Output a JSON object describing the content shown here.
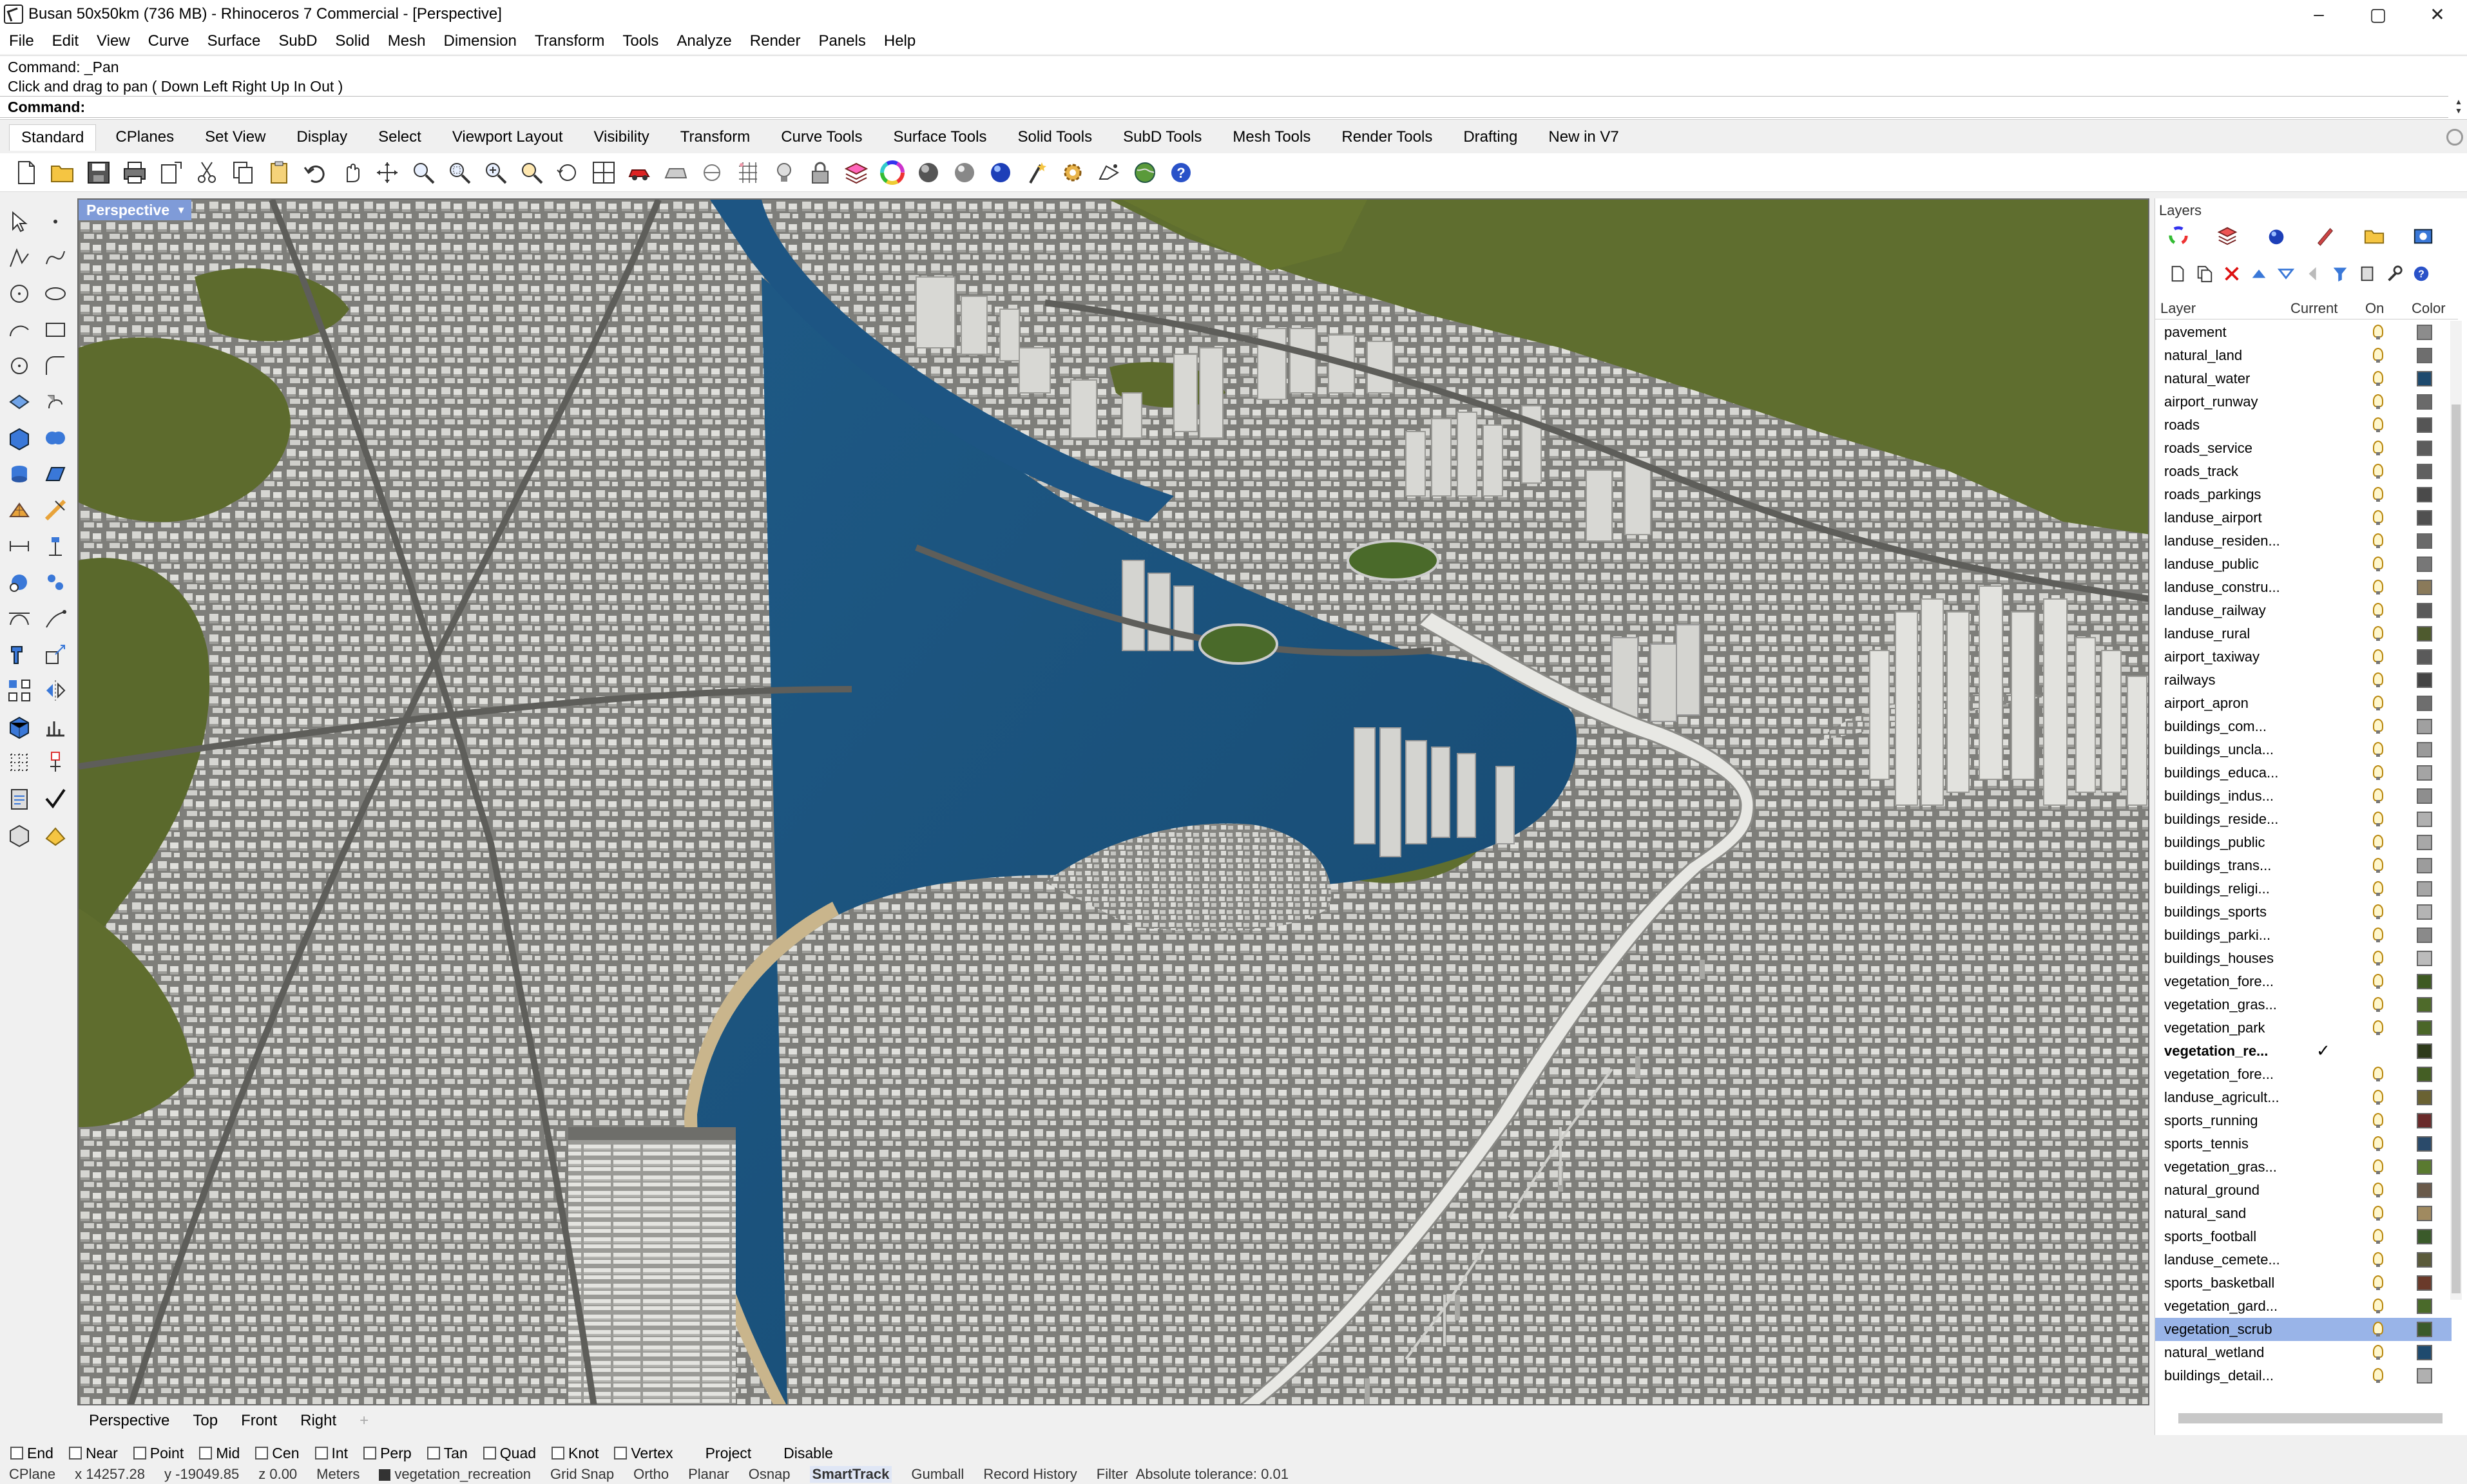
{
  "window": {
    "title": "Busan 50x50km (736 MB) - Rhinoceros 7 Commercial - [Perspective]",
    "minimize": "–",
    "maximize": "▢",
    "close": "✕"
  },
  "menu": [
    "File",
    "Edit",
    "View",
    "Curve",
    "Surface",
    "SubD",
    "Solid",
    "Mesh",
    "Dimension",
    "Transform",
    "Tools",
    "Analyze",
    "Render",
    "Panels",
    "Help"
  ],
  "command": {
    "history_1": "Command: _Pan",
    "history_2": "Click and drag to pan ( Down  Left  Right  Up  In  Out )",
    "prompt_label": "Command:",
    "input_value": ""
  },
  "toolbar_tabs": [
    "Standard",
    "CPlanes",
    "Set View",
    "Display",
    "Select",
    "Viewport Layout",
    "Visibility",
    "Transform",
    "Curve Tools",
    "Surface Tools",
    "Solid Tools",
    "SubD Tools",
    "Mesh Tools",
    "Render Tools",
    "Drafting",
    "New in V7"
  ],
  "active_tab": "Standard",
  "viewport": {
    "label": "Perspective",
    "caret": "▾"
  },
  "viewport_tabs": [
    "Perspective",
    "Top",
    "Front",
    "Right"
  ],
  "viewport_tab_add": "+",
  "layers": {
    "panel_title": "Layers",
    "columns": {
      "layer": "Layer",
      "current": "Current",
      "on": "On",
      "color": "Color"
    },
    "check_mark": "✓",
    "items": [
      {
        "name": "pavement",
        "color": "#8c8c8c"
      },
      {
        "name": "natural_land",
        "color": "#6e6e6e"
      },
      {
        "name": "natural_water",
        "color": "#1e4a6e"
      },
      {
        "name": "airport_runway",
        "color": "#6a6a6a"
      },
      {
        "name": "roads",
        "color": "#555555"
      },
      {
        "name": "roads_service",
        "color": "#5c5c5c"
      },
      {
        "name": "roads_track",
        "color": "#606060"
      },
      {
        "name": "roads_parkings",
        "color": "#4a4a4a"
      },
      {
        "name": "landuse_airport",
        "color": "#505050"
      },
      {
        "name": "landuse_residen...",
        "color": "#6a6a6a"
      },
      {
        "name": "landuse_public",
        "color": "#777777"
      },
      {
        "name": "landuse_constru...",
        "color": "#8a7a5a"
      },
      {
        "name": "landuse_railway",
        "color": "#5a5a5a"
      },
      {
        "name": "landuse_rural",
        "color": "#4e5a2e"
      },
      {
        "name": "airport_taxiway",
        "color": "#5a5a5a"
      },
      {
        "name": "railways",
        "color": "#444444"
      },
      {
        "name": "airport_apron",
        "color": "#6e6e6e"
      },
      {
        "name": "buildings_com...",
        "color": "#a0a0a0"
      },
      {
        "name": "buildings_uncla...",
        "color": "#9a9a9a"
      },
      {
        "name": "buildings_educa...",
        "color": "#a4a4a4"
      },
      {
        "name": "buildings_indus...",
        "color": "#8e8e8e"
      },
      {
        "name": "buildings_reside...",
        "color": "#b0b0b0"
      },
      {
        "name": "buildings_public",
        "color": "#a8a8a8"
      },
      {
        "name": "buildings_trans...",
        "color": "#9c9c9c"
      },
      {
        "name": "buildings_religi...",
        "color": "#a6a6a6"
      },
      {
        "name": "buildings_sports",
        "color": "#b4b4b4"
      },
      {
        "name": "buildings_parki...",
        "color": "#8a8a8a"
      },
      {
        "name": "buildings_houses",
        "color": "#bcbcbc"
      },
      {
        "name": "vegetation_fore...",
        "color": "#3e5a22"
      },
      {
        "name": "vegetation_gras...",
        "color": "#4e6a2a"
      },
      {
        "name": "vegetation_park",
        "color": "#4a6628"
      },
      {
        "name": "vegetation_re...",
        "color": "#2e3a1a",
        "current": true
      },
      {
        "name": "vegetation_fore...",
        "color": "#445e24"
      },
      {
        "name": "landuse_agricult...",
        "color": "#6a6232"
      },
      {
        "name": "sports_running",
        "color": "#6a2a2a"
      },
      {
        "name": "sports_tennis",
        "color": "#2a4a6a"
      },
      {
        "name": "vegetation_gras...",
        "color": "#5a7a30"
      },
      {
        "name": "natural_ground",
        "color": "#6a5a4a"
      },
      {
        "name": "natural_sand",
        "color": "#a08a60"
      },
      {
        "name": "sports_football",
        "color": "#3a5a2a"
      },
      {
        "name": "landuse_cemete...",
        "color": "#5a5a3a"
      },
      {
        "name": "sports_basketball",
        "color": "#6a3a2a"
      },
      {
        "name": "vegetation_gard...",
        "color": "#4a6a2a"
      },
      {
        "name": "vegetation_scrub",
        "color": "#3a5a2a",
        "selected": true
      },
      {
        "name": "natural_wetland",
        "color": "#1e4a6e"
      },
      {
        "name": "buildings_detail...",
        "color": "#b0b0b0"
      }
    ]
  },
  "osnap": {
    "items": [
      {
        "label": "End"
      },
      {
        "label": "Near"
      },
      {
        "label": "Point"
      },
      {
        "label": "Mid"
      },
      {
        "label": "Cen"
      },
      {
        "label": "Int"
      },
      {
        "label": "Perp"
      },
      {
        "label": "Tan"
      },
      {
        "label": "Quad"
      },
      {
        "label": "Knot"
      },
      {
        "label": "Vertex"
      },
      {
        "label": "Project"
      },
      {
        "label": "Disable"
      }
    ]
  },
  "status": {
    "cplane": "CPlane",
    "x": "x 14257.28",
    "y": "y -19049.85",
    "z": "z 0.00",
    "units": "Meters",
    "layer": "vegetation_recreation",
    "grid_snap": "Grid Snap",
    "ortho": "Ortho",
    "planar": "Planar",
    "osnap": "Osnap",
    "smarttrack": "SmartTrack",
    "gumball": "Gumball",
    "record_history": "Record History",
    "filter": "Filter",
    "tolerance": "Absolute tolerance: 0.01"
  },
  "colors": {
    "water": "#1a4f7a",
    "vegetation": "#5a6b2e",
    "buildings": "#cfcfcb",
    "viewport_label": "#7f9bd8",
    "selected_row": "#99b4e8"
  }
}
